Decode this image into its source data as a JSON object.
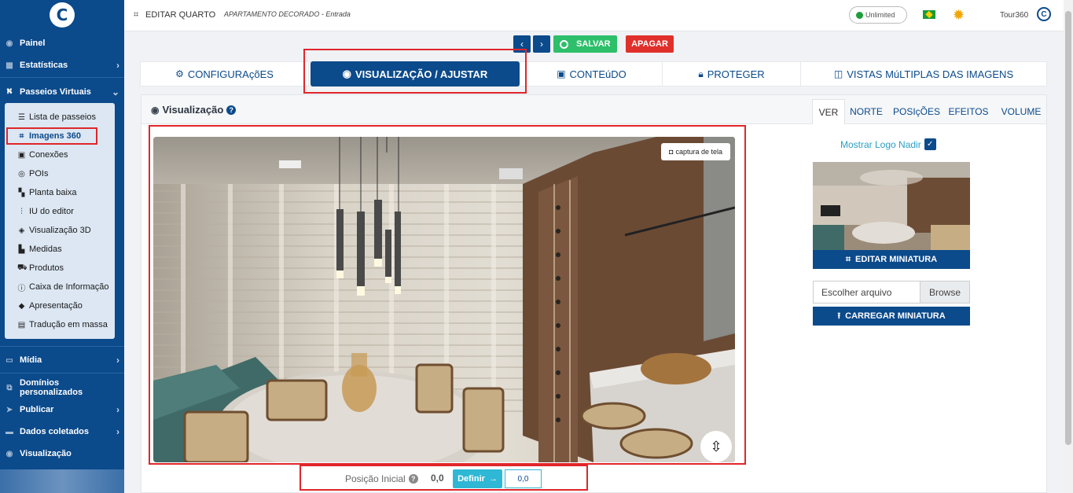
{
  "sidebar": {
    "items_top": [
      {
        "label": "Painel",
        "icon": "dashboard-icon"
      },
      {
        "label": "Estatísticas",
        "icon": "chart-icon"
      },
      {
        "label": "Passeios Virtuais",
        "icon": "route-icon"
      }
    ],
    "submenu": [
      {
        "label": "Lista de passeios",
        "icon": "list-icon"
      },
      {
        "label": "Imagens 360",
        "icon": "crop-icon",
        "active": true
      },
      {
        "label": "Conexões",
        "icon": "image-icon"
      },
      {
        "label": "POIs",
        "icon": "target-icon"
      },
      {
        "label": "Planta baixa",
        "icon": "map-icon"
      },
      {
        "label": "IU do editor",
        "icon": "sliders-icon"
      },
      {
        "label": "Visualização 3D",
        "icon": "cube-icon"
      },
      {
        "label": "Medidas",
        "icon": "ruler-icon"
      },
      {
        "label": "Produtos",
        "icon": "cart-icon"
      },
      {
        "label": "Caixa de Informação",
        "icon": "info-icon"
      },
      {
        "label": "Apresentação",
        "icon": "diamond-icon"
      },
      {
        "label": "Tradução em massa",
        "icon": "language-icon"
      }
    ],
    "items_bottom": [
      {
        "label": "Mídia",
        "icon": "monitor-icon"
      },
      {
        "label": "Domínios personalizados",
        "icon": "network-icon"
      },
      {
        "label": "Publicar",
        "icon": "send-icon"
      },
      {
        "label": "Dados coletados",
        "icon": "database-icon"
      },
      {
        "label": "Visualização",
        "icon": "eye-icon"
      }
    ]
  },
  "topbar": {
    "title": "EDITAR QUARTO",
    "subtitle": "APARTAMENTO DECORADO - Entrada",
    "plan": "Unlimited",
    "user": "Tour360"
  },
  "actions": {
    "save": "SALVAR",
    "delete": "APAGAR"
  },
  "tabs": [
    {
      "label": "CONFIGURAçõES",
      "icon": "gears-icon"
    },
    {
      "label": "VISUALIZAÇÃO / AJUSTAR",
      "icon": "eye-icon",
      "active": true
    },
    {
      "label": "CONTEúDO",
      "icon": "images-icon"
    },
    {
      "label": "PROTEGER",
      "icon": "lock-icon"
    },
    {
      "label": "VISTAS MúLTIPLAS DAS IMAGENS",
      "icon": "columns-icon"
    }
  ],
  "panel": {
    "title": "Visualização",
    "right_tabs": [
      "VER",
      "NORTE",
      "POSIçÕES",
      "EFEITOS",
      "VOLUME"
    ],
    "capture_label": "captura de tela",
    "initial_position_label": "Posição Inicial",
    "initial_position_value": "0,0",
    "define_label": "Definir",
    "position_input": "0,0"
  },
  "right": {
    "logo_nadir": "Mostrar Logo Nadir",
    "edit_thumb": "EDITAR MINIATURA",
    "file_placeholder": "Escolher arquivo",
    "browse": "Browse",
    "upload_thumb": "CARREGAR MINIATURA"
  },
  "colors": {
    "primary": "#0b4a8b",
    "success": "#2dbf6a",
    "danger": "#e0302b",
    "info": "#2fb8d5",
    "highlight": "#e0262a"
  }
}
